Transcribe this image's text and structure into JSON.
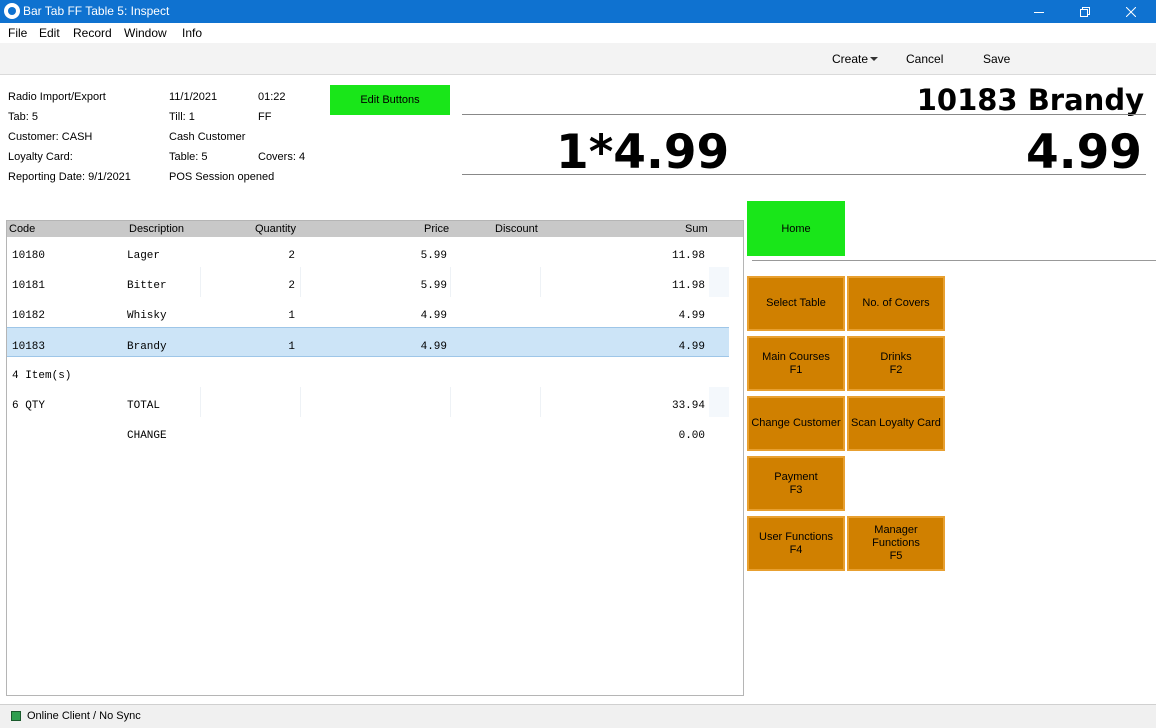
{
  "window": {
    "title": "Bar Tab FF Table 5: Inspect"
  },
  "menu": [
    "File",
    "Edit",
    "Record",
    "Window",
    "Info"
  ],
  "toolbar": {
    "create": "Create",
    "cancel": "Cancel",
    "save": "Save"
  },
  "info": {
    "r1c1": "Radio Import/Export",
    "r1c2": "11/1/2021",
    "r1c3": "01:22",
    "r2c1": "Tab: 5",
    "r2c2": "Till: 1",
    "r2c3": "FF",
    "r3c1": "Customer: CASH",
    "r3c2": "Cash Customer",
    "r4c1": "Loyalty Card:",
    "r4c2": "Table: 5",
    "r4c3": "Covers: 4",
    "r5c1": "Reporting Date: 9/1/2021",
    "r5c2": "POS Session opened"
  },
  "edit_buttons": "Edit Buttons",
  "display": {
    "item": "10183 Brandy",
    "qty_price": "1*4.99",
    "total": "4.99"
  },
  "table": {
    "headers": [
      "Code",
      "Description",
      "Quantity",
      "Price",
      "Discount",
      "Sum"
    ],
    "rows": [
      {
        "code": "10180",
        "desc": "Lager",
        "qty": "2",
        "price": "5.99",
        "sum": "11.98"
      },
      {
        "code": "10181",
        "desc": "Bitter",
        "qty": "2",
        "price": "5.99",
        "sum": "11.98"
      },
      {
        "code": "10182",
        "desc": "Whisky",
        "qty": "1",
        "price": "4.99",
        "sum": "4.99"
      },
      {
        "code": "10183",
        "desc": "Brandy",
        "qty": "1",
        "price": "4.99",
        "sum": "4.99"
      }
    ],
    "items_count": "4 Item(s)",
    "total_qty": "6 QTY",
    "total_label": "TOTAL",
    "total_sum": "33.94",
    "change_label": "CHANGE",
    "change_sum": "0.00"
  },
  "buttons": {
    "home": "Home",
    "select_table": "Select Table",
    "covers": "No. of Covers",
    "main_courses": "Main Courses",
    "main_courses_key": "F1",
    "drinks": "Drinks",
    "drinks_key": "F2",
    "change_customer": "Change Customer",
    "scan_loyalty": "Scan Loyalty Card",
    "payment": "Payment",
    "payment_key": "F3",
    "user_functions": "User Functions",
    "user_functions_key": "F4",
    "manager_functions": "Manager Functions",
    "manager_functions_key": "F5"
  },
  "status": {
    "text": "Online Client / No Sync"
  },
  "colors": {
    "titlebar": "#0f72d0",
    "green_button": "#19e619",
    "function_button": "#d08000",
    "selected_row": "#cce4f7"
  }
}
